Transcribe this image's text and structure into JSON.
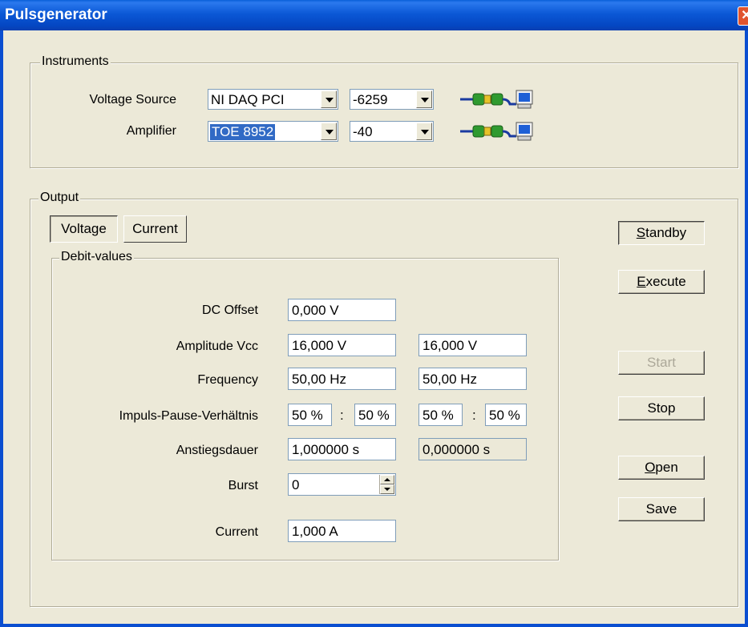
{
  "window": {
    "title": "Pulsgenerator",
    "close_symbol": "✕"
  },
  "instruments": {
    "legend": "Instruments",
    "voltage_source": {
      "label": "Voltage Source",
      "device": "NI DAQ PCI",
      "model": "-6259",
      "status_icon": "connected-plug-icon"
    },
    "amplifier": {
      "label": "Amplifier",
      "device": "TOE 8952",
      "model": "-40",
      "status_icon": "connected-plug-icon"
    }
  },
  "output": {
    "legend": "Output",
    "tabs": [
      {
        "label": "Voltage",
        "active": true
      },
      {
        "label": "Current",
        "active": false
      }
    ],
    "debit": {
      "legend": "Debit-values",
      "dc_offset": {
        "label": "DC Offset",
        "value": "0,000 V"
      },
      "amplitude": {
        "label": "Amplitude Vcc",
        "value1": "16,000 V",
        "value2": "16,000 V"
      },
      "frequency": {
        "label": "Frequency",
        "value1": "50,00 Hz",
        "value2": "50,00 Hz"
      },
      "impuls": {
        "label": "Impuls-Pause-Verhältnis",
        "a1": "50 %",
        "b1": "50 %",
        "a2": "50 %",
        "b2": "50 %",
        "sep": ":"
      },
      "anstieg": {
        "label": "Anstiegsdauer",
        "value1": "1,000000 s",
        "value2": "0,000000 s"
      },
      "burst": {
        "label": "Burst",
        "value": "0"
      },
      "current": {
        "label": "Current",
        "value": "1,000 A"
      }
    }
  },
  "buttons": {
    "standby": {
      "mnemonic": "S",
      "rest": "tandby"
    },
    "execute": {
      "mnemonic": "E",
      "rest": "xecute"
    },
    "start": "Start",
    "stop": "Stop",
    "open": {
      "mnemonic": "O",
      "rest": "pen"
    },
    "save": "Save"
  }
}
